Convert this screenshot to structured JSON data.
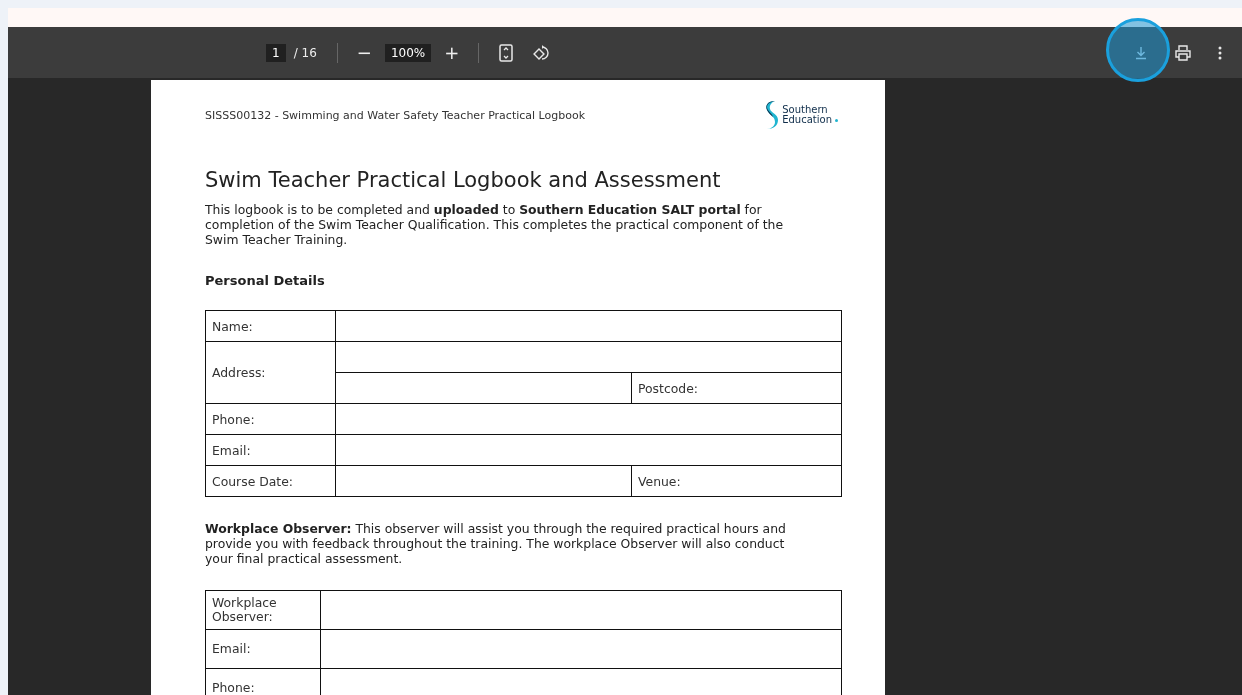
{
  "toolbar": {
    "page_current": "1",
    "page_total": "/ 16",
    "zoom_out": "−",
    "zoom": "100%",
    "zoom_in": "+",
    "download_highlighted": true
  },
  "document": {
    "header": "SISSS00132 - Swimming and Water Safety Teacher Practical Logbook",
    "logo": {
      "line_1": "Southern",
      "line_2": "Education"
    },
    "title": "Swim Teacher Practical Logbook and Assessment",
    "intro": "This logbook is to be completed and **uploaded** to **Southern Education SALT portal** for completion of the Swim Teacher Qualification. This completes the practical component of the Swim Teacher Training.",
    "personal_heading": "Personal Details",
    "personal_rows": [
      {
        "kind": "single",
        "label": "Name:"
      },
      {
        "kind": "address",
        "label": "Address:",
        "second_label": "Postcode:"
      },
      {
        "kind": "single",
        "label": "Phone:"
      },
      {
        "kind": "single",
        "label": "Email:"
      },
      {
        "kind": "split",
        "label": "Course Date:",
        "second_label": "Venue:"
      }
    ],
    "observer_text": "**Workplace Observer:** This observer will assist you through the required practical hours and provide you with feedback throughout the training. The workplace Observer will also conduct your final practical assessment.",
    "observer_rows": [
      {
        "label": "Workplace Observer:"
      },
      {
        "label": "Email:"
      },
      {
        "label": "Phone:"
      }
    ]
  }
}
